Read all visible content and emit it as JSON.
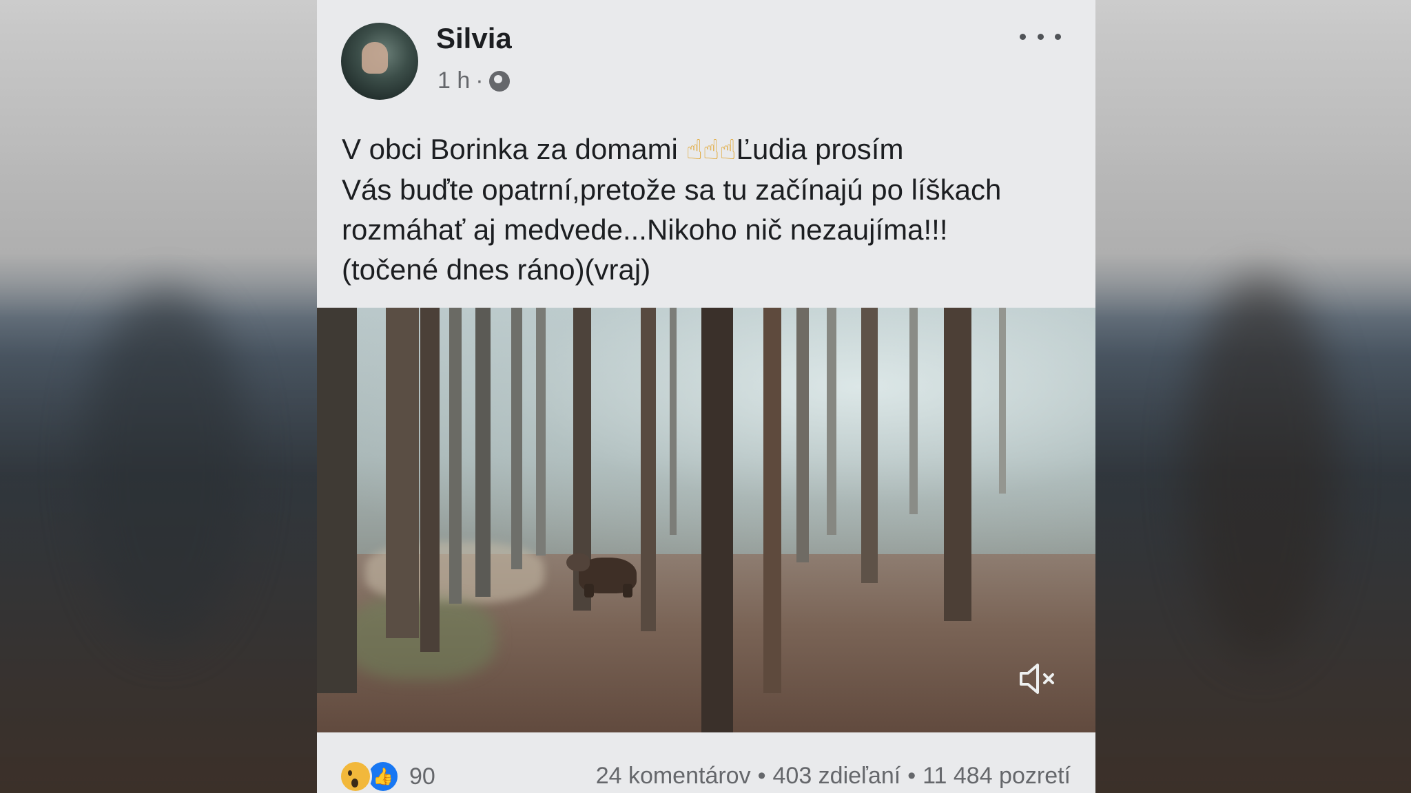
{
  "post": {
    "author": "Silvia",
    "time": "1 h",
    "meta_separator": "·",
    "text_lines": [
      {
        "before": "V obci Borinka za domami ",
        "emoji": "☝☝☝",
        "after": "Ľudia prosím"
      },
      {
        "text": "Vás buďte opatrní,pretože sa tu začínajú po líškach"
      },
      {
        "text": "rozmáhať aj medvede...Nikoho nič nezaujíma!!!"
      },
      {
        "text": "(točené dnes ráno)(vraj)"
      }
    ]
  },
  "icons": {
    "more": "more-options-icon",
    "privacy": "globe-icon",
    "video_sound": "muted-speaker-icon",
    "reaction_1": "wow-reaction-icon",
    "reaction_2": "like-reaction-icon"
  },
  "footer": {
    "reaction_count": "90",
    "comments": "24 komentárov",
    "shares": "403 zdieľaní",
    "views": "11 484 pozretí",
    "separator": "•"
  },
  "colors": {
    "card_bg": "#e9eaec",
    "text": "#1c1e21",
    "muted": "#65676b",
    "like_blue": "#1877f2",
    "wow_yellow": "#f2b83b"
  }
}
